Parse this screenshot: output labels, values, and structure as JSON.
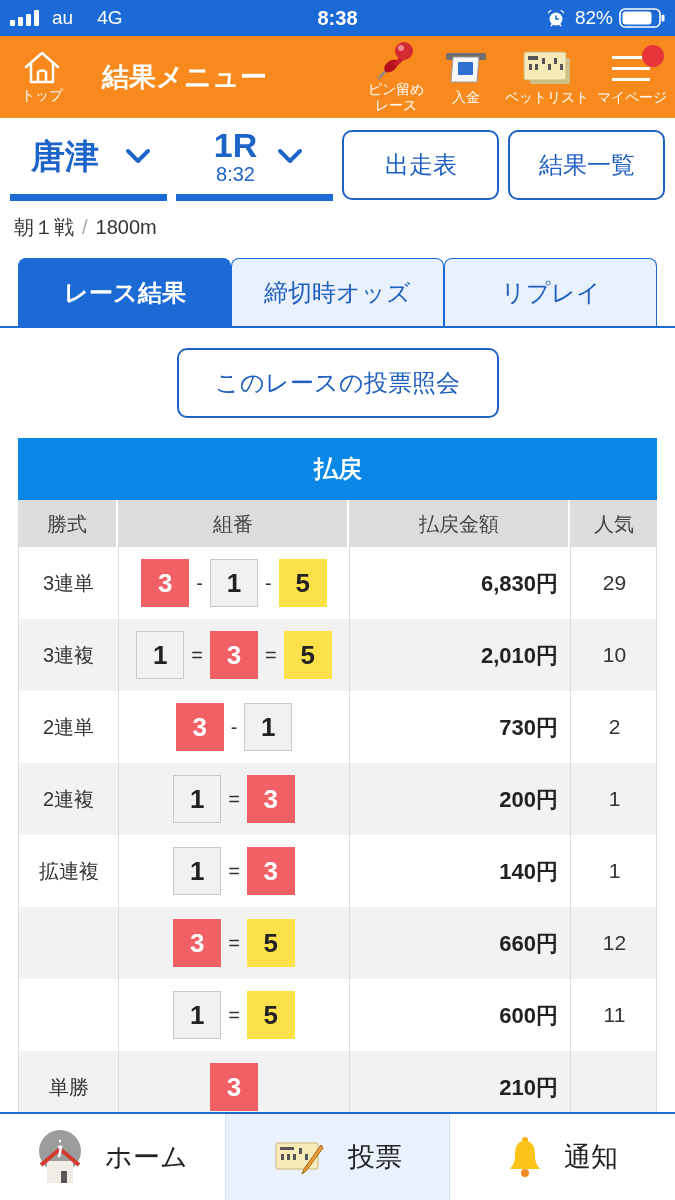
{
  "status_bar": {
    "carrier": "au",
    "network": "4G",
    "time": "8:38",
    "battery": "82%"
  },
  "header": {
    "home": {
      "label": "トップ"
    },
    "title": "結果メニュー",
    "actions": [
      {
        "kind": "pin",
        "label": "ピン留めレース"
      },
      {
        "kind": "deposit",
        "label": "入金"
      },
      {
        "kind": "betlist",
        "label": "ベットリスト"
      },
      {
        "kind": "menu",
        "label": "マイページ",
        "notification": true
      }
    ]
  },
  "selectors": {
    "venue": "唐津",
    "race": {
      "number": "1R",
      "time": "8:32"
    },
    "buttons": [
      "出走表",
      "結果一覧"
    ]
  },
  "race_info": {
    "name": "朝１戦",
    "separator": "/",
    "distance": "1800m"
  },
  "tabs": [
    {
      "label": "レース結果",
      "selected": true
    },
    {
      "label": "締切時オッズ",
      "selected": false
    },
    {
      "label": "リプレイ",
      "selected": false
    }
  ],
  "inquiry_button": "このレースの投票照会",
  "payout_table": {
    "title": "払戻",
    "columns": [
      "勝式",
      "組番",
      "払戻金額",
      "人気"
    ],
    "rows": [
      {
        "type": "3連単",
        "combo": [
          {
            "kind": "boat",
            "number": "3",
            "color": "#f06064"
          },
          {
            "kind": "separator",
            "text": "-"
          },
          {
            "kind": "boat",
            "number": "1",
            "color": "#f1f1f1"
          },
          {
            "kind": "separator",
            "text": "-"
          },
          {
            "kind": "boat",
            "number": "5",
            "color": "#fce14b"
          }
        ],
        "payout": "6,830円",
        "popularity": "29"
      },
      {
        "type": "3連複",
        "combo": [
          {
            "kind": "boat",
            "number": "1",
            "color": "#f1f1f1"
          },
          {
            "kind": "separator",
            "text": "="
          },
          {
            "kind": "boat",
            "number": "3",
            "color": "#f06064"
          },
          {
            "kind": "separator",
            "text": "="
          },
          {
            "kind": "boat",
            "number": "5",
            "color": "#fce14b"
          }
        ],
        "payout": "2,010円",
        "popularity": "10"
      },
      {
        "type": "2連単",
        "combo": [
          {
            "kind": "boat",
            "number": "3",
            "color": "#f06064"
          },
          {
            "kind": "separator",
            "text": "-"
          },
          {
            "kind": "boat",
            "number": "1",
            "color": "#f1f1f1"
          }
        ],
        "payout": "730円",
        "popularity": "2"
      },
      {
        "type": "2連複",
        "combo": [
          {
            "kind": "boat",
            "number": "1",
            "color": "#f1f1f1"
          },
          {
            "kind": "separator",
            "text": "="
          },
          {
            "kind": "boat",
            "number": "3",
            "color": "#f06064"
          }
        ],
        "payout": "200円",
        "popularity": "1"
      },
      {
        "type": "拡連複",
        "combo": [
          {
            "kind": "boat",
            "number": "1",
            "color": "#f1f1f1"
          },
          {
            "kind": "separator",
            "text": "="
          },
          {
            "kind": "boat",
            "number": "3",
            "color": "#f06064"
          }
        ],
        "payout": "140円",
        "popularity": "1"
      },
      {
        "combo": [
          {
            "kind": "boat",
            "number": "3",
            "color": "#f06064"
          },
          {
            "kind": "separator",
            "text": "="
          },
          {
            "kind": "boat",
            "number": "5",
            "color": "#fce14b"
          }
        ],
        "payout": "660円",
        "popularity": "12"
      },
      {
        "combo": [
          {
            "kind": "boat",
            "number": "1",
            "color": "#f1f1f1"
          },
          {
            "kind": "separator",
            "text": "="
          },
          {
            "kind": "boat",
            "number": "5",
            "color": "#fce14b"
          }
        ],
        "payout": "600円",
        "popularity": "11"
      },
      {
        "type": "単勝",
        "combo": [
          {
            "kind": "boat",
            "number": "3",
            "color": "#f06064"
          }
        ],
        "payout": "210円"
      }
    ]
  },
  "bottom_nav": [
    {
      "kind": "home",
      "label": "ホーム",
      "selected": false
    },
    {
      "kind": "vote",
      "label": "投票",
      "selected": true
    },
    {
      "kind": "notice",
      "label": "通知",
      "selected": false
    }
  ]
}
